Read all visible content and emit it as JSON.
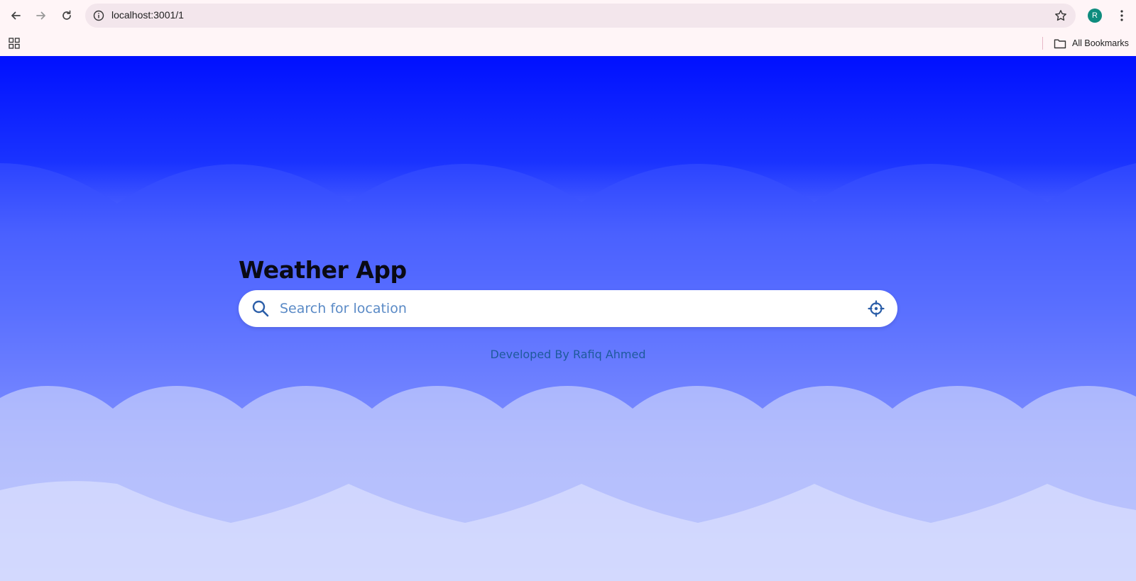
{
  "browser": {
    "url": "localhost:3001/1",
    "profile_initial": "R",
    "bookmarks_label": "All Bookmarks",
    "icons": [
      "back-icon",
      "forward-icon",
      "reload-icon",
      "info-icon",
      "star-icon",
      "kebab-icon",
      "apps-icon",
      "folder-icon"
    ]
  },
  "app": {
    "title": "Weather App",
    "search": {
      "placeholder": "Search for location",
      "value": ""
    },
    "credit": "Developed By Rafiq Ahmed"
  },
  "colors": {
    "sky_top": "#0010ff",
    "sky_bottom": "#ffffff",
    "accent": "#2b5ea8",
    "avatar": "#0f8c7e"
  }
}
